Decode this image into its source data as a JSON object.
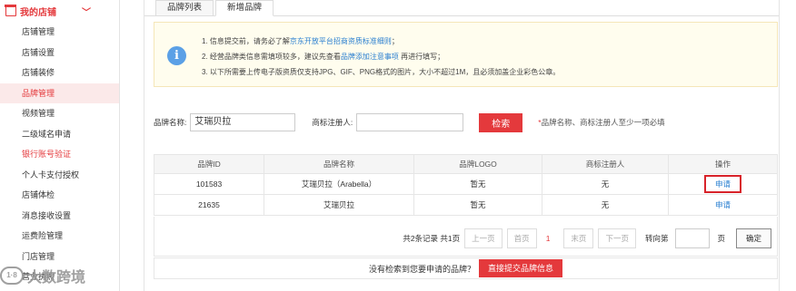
{
  "sidebar": {
    "title": "我的店铺",
    "items": [
      {
        "label": "店铺管理"
      },
      {
        "label": "店铺设置"
      },
      {
        "label": "店铺装修"
      },
      {
        "label": "品牌管理"
      },
      {
        "label": "视频管理"
      },
      {
        "label": "二级域名申请"
      },
      {
        "label": "银行账号验证"
      },
      {
        "label": "个人卡支付授权"
      },
      {
        "label": "店铺体检"
      },
      {
        "label": "消息接收设置"
      },
      {
        "label": "运费险管理"
      },
      {
        "label": "门店管理"
      },
      {
        "label": "营业执照"
      }
    ]
  },
  "tabs": [
    {
      "label": "品牌列表"
    },
    {
      "label": "新增品牌"
    }
  ],
  "notice": {
    "line1_pre": "1. 信息提交前，请务必了解",
    "line1_link": "京东开放平台招商资质标准细则",
    "line1_post": "；",
    "line2_pre": "2. 经营品牌类信息需填项较多，建议先查看",
    "line2_link": "品牌添加注意事项",
    "line2_post": " 再进行填写；",
    "line3": "3. 以下所需要上传电子版资质仅支持JPG、GIF、PNG格式的图片，大小不超过1M，且必须加盖企业彩色公章。"
  },
  "search": {
    "brand_label": "品牌名称:",
    "brand_value": "艾瑞贝拉",
    "owner_label": "商标注册人:",
    "owner_value": "",
    "button": "检索",
    "required_star": "*",
    "required_note": "品牌名称、商标注册人至少一项必填"
  },
  "table": {
    "headers": [
      "品牌ID",
      "品牌名称",
      "品牌LOGO",
      "商标注册人",
      "操作"
    ],
    "rows": [
      {
        "id": "101583",
        "name": "艾瑞贝拉（Arabella）",
        "logo": "暂无",
        "owner": "无",
        "op": "申请"
      },
      {
        "id": "21635",
        "name": "艾瑞贝拉",
        "logo": "暂无",
        "owner": "无",
        "op": "申请"
      }
    ]
  },
  "pager": {
    "summary": "共2条记录  共1页",
    "prev": "上一页",
    "first": "首页",
    "current": "1",
    "last": "末页",
    "next": "下一页",
    "goto": "转向第",
    "page_unit": "页",
    "ok": "确定"
  },
  "bottom": {
    "question": "没有检索到您要申请的品牌？",
    "submit": "直接提交品牌信息"
  },
  "watermark": {
    "text": "大数跨境",
    "logo_text": "1·8"
  }
}
